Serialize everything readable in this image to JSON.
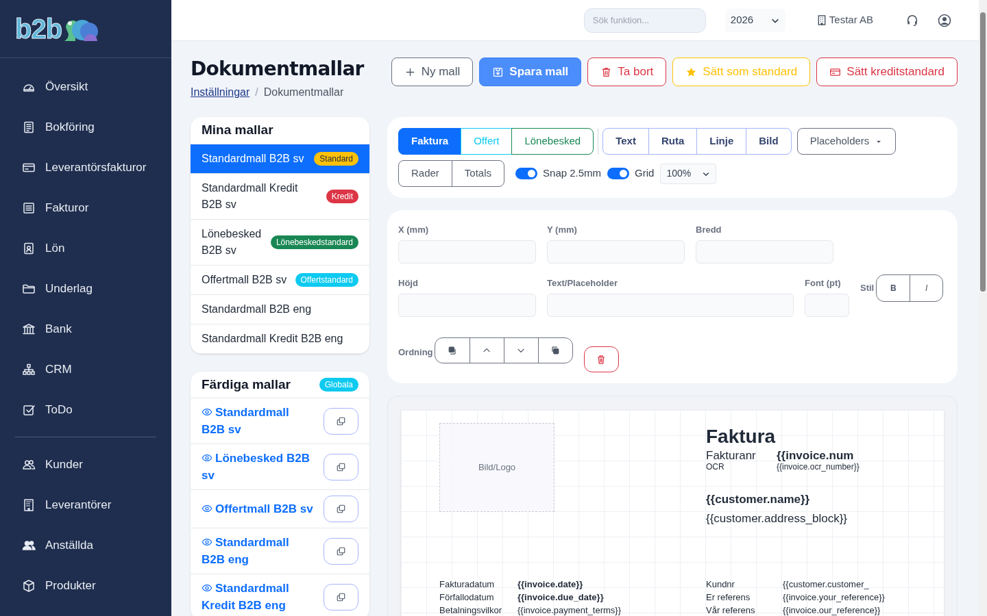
{
  "logo": "b2b",
  "sidebar": {
    "groups": [
      [
        {
          "label": "Översikt"
        },
        {
          "label": "Bokföring"
        },
        {
          "label": "Leverantörsfakturor"
        },
        {
          "label": "Fakturor"
        },
        {
          "label": "Lön"
        },
        {
          "label": "Underlag"
        },
        {
          "label": "Bank"
        },
        {
          "label": "CRM"
        },
        {
          "label": "ToDo"
        }
      ],
      [
        {
          "label": "Kunder"
        },
        {
          "label": "Leverantörer"
        },
        {
          "label": "Anställda"
        },
        {
          "label": "Produkter"
        }
      ]
    ]
  },
  "topbar": {
    "search": {
      "placeholder": "Sök funktion..."
    },
    "year": "2026",
    "company": "Testar AB"
  },
  "page": {
    "title": "Dokumentmallar",
    "separator": "/",
    "breadcrumb": [
      {
        "label": "Inställningar",
        "link": true
      },
      {
        "label": "Dokumentmallar",
        "link": false
      }
    ]
  },
  "actions": [
    {
      "label": "Ny mall",
      "kind": "outline"
    },
    {
      "label": "Spara mall",
      "kind": "primary"
    },
    {
      "label": "Ta bort",
      "kind": "danger"
    },
    {
      "label": "Sätt som standard",
      "kind": "warning"
    },
    {
      "label": "Sätt kreditstandard",
      "kind": "danger"
    }
  ],
  "my_templates": {
    "title": "Mina mallar",
    "items": [
      {
        "name": "Standardmall B2B sv",
        "badge": {
          "text": "Standard",
          "color": "#ffc107"
        },
        "selected": true
      },
      {
        "name": "Standardmall Kredit B2B sv",
        "badge": {
          "text": "Kredit",
          "color": "#dc3545"
        },
        "selected": false
      },
      {
        "name": "Lönebesked B2B sv",
        "badge": {
          "text": "Lönebeskedstandard",
          "color": "#198754"
        },
        "selected": false
      },
      {
        "name": "Offertmall B2B sv",
        "badge": {
          "text": "Offertstandard",
          "color": "#0dcaf0"
        },
        "selected": false
      },
      {
        "name": "Standardmall B2B eng",
        "selected": false
      },
      {
        "name": "Standardmall Kredit B2B eng",
        "selected": false
      }
    ]
  },
  "ready_templates": {
    "title": "Färdiga mallar",
    "badge": {
      "text": "Globala",
      "color": "#0dcaf0"
    },
    "items": [
      {
        "name": "Standardmall B2B sv"
      },
      {
        "name": "Lönebesked B2B sv"
      },
      {
        "name": "Offertmall B2B sv"
      },
      {
        "name": "Standardmall B2B eng"
      },
      {
        "name": "Standardmall Kredit B2B eng"
      }
    ]
  },
  "editor": {
    "doc_types": [
      {
        "label": "Faktura",
        "color": "#0d6efd",
        "selected": true
      },
      {
        "label": "Offert",
        "color": "#0dcaf0",
        "selected": false
      },
      {
        "label": "Lönebesked",
        "color": "#198754",
        "selected": false
      }
    ],
    "tools": [
      "Text",
      "Ruta",
      "Linje",
      "Bild"
    ],
    "placeholders": "Placeholders",
    "sections": [
      "Rader",
      "Totals"
    ],
    "toggles": [
      {
        "label": "Snap 2.5mm",
        "on": true
      },
      {
        "label": "Grid",
        "on": true
      }
    ],
    "zoom": "100%"
  },
  "properties": {
    "rows": [
      [
        {
          "label": "X (mm)"
        },
        {
          "label": "Y (mm)"
        },
        {
          "label": "Bredd"
        }
      ],
      [
        {
          "label": "Höjd"
        },
        {
          "label": "Text/Placeholder"
        },
        {
          "label": "Font (pt)"
        }
      ]
    ],
    "style_label": "Stil",
    "style_buttons": [
      "B",
      "I"
    ],
    "order_label": "Ordning"
  },
  "canvas": {
    "logo_placeholder": "Bild/Logo",
    "title": "Faktura",
    "header_rows": [
      {
        "label": "Fakturanr",
        "value": "{{invoice.num",
        "kind": "large"
      },
      {
        "label": "OCR",
        "value": "{{invoice.ocr_number}}",
        "kind": "small"
      }
    ],
    "customer_name": "{{customer.name}}",
    "customer_address": "{{customer.address_block}}",
    "info_left": [
      {
        "label": "Fakturadatum",
        "value": "{{invoice.date}}",
        "bold": true
      },
      {
        "label": "Förfallodatum",
        "value": "{{invoice.due_date}}",
        "bold": true
      },
      {
        "label": "Betalningsvilkor",
        "value": "{{invoice.payment_terms}}",
        "bold": false
      }
    ],
    "info_right": [
      {
        "label": "Kundnr",
        "value": "{{customer.customer_",
        "bold": false
      },
      {
        "label": "Er referens",
        "value": "{{invoice.your_reference}}",
        "bold": false
      },
      {
        "label": "Vår referens",
        "value": "{{invoice.our_reference}}",
        "bold": false
      }
    ]
  }
}
